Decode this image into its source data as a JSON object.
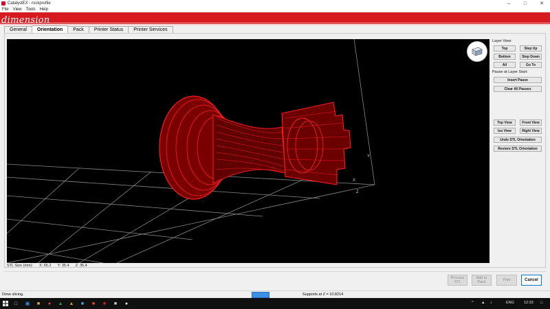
{
  "window": {
    "title": "CatalystEX - rockprofile"
  },
  "menu": [
    "File",
    "View",
    "Tools",
    "Help"
  ],
  "brand": {
    "logo_text": "dimension",
    "color": "#d71920"
  },
  "tabs": [
    "General",
    "Orientation",
    "Pack",
    "Printer Status",
    "Printer Services"
  ],
  "active_tab": "Orientation",
  "side_panel": {
    "layer_view_label": "Layer View:",
    "top": "Top",
    "step_up": "Step Up",
    "bottom": "Bottom",
    "step_down": "Step Down",
    "all": "All",
    "go_to": "Go To",
    "pause_label": "Pause at Layer Start:",
    "insert_pause": "Insert Pause",
    "clear_all_pauses": "Clear All Pauses",
    "top_view": "Top View",
    "front_view": "Front View",
    "iso_view": "Iso View",
    "right_view": "Right View",
    "undo_stl": "Undo STL Orientation",
    "restore_stl": "Restore STL Orientation"
  },
  "viewport": {
    "axis_x_label": "X",
    "axis_y_label": "Y",
    "axis_z_label": "Z",
    "model_color": "#ff0000"
  },
  "stl_size": {
    "label": "STL Size (mm):",
    "x": "X: 65.2",
    "y": "Y: 35.4",
    "z": "Z: 35.4"
  },
  "actions": {
    "process_stl": "Process STL",
    "add_to_pack": "Add to Pack",
    "print": "Print",
    "cancel": "Cancel"
  },
  "status": {
    "left": "Done slicing.",
    "progress": 1.0,
    "middle": "Supports at Z = 10.8214"
  },
  "taskbar": {
    "language": "ENG",
    "time": "12:33"
  }
}
